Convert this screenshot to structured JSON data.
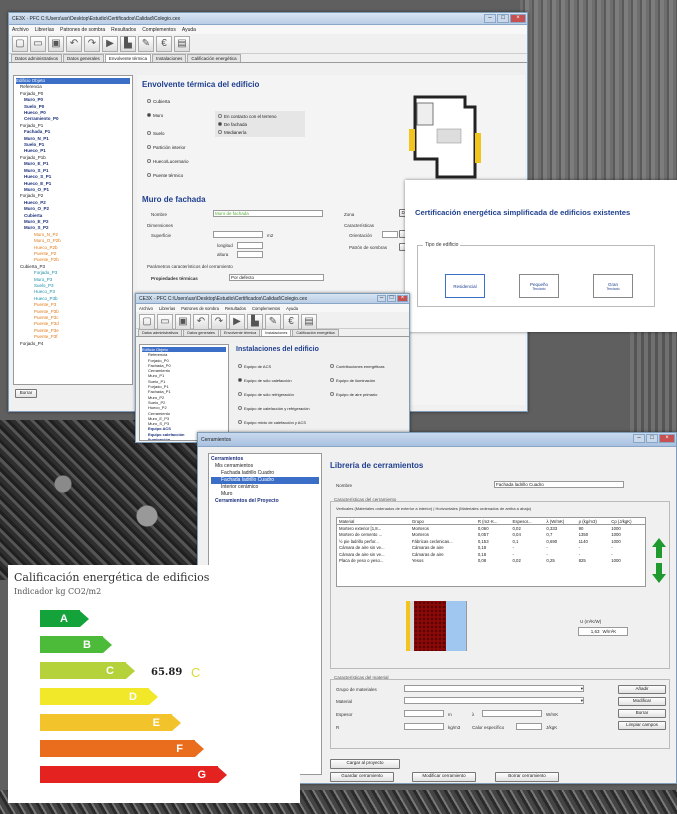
{
  "colors": {
    "accent": "#1f3f8f",
    "selection": "#3b6fc7",
    "orange": "#e07b1a",
    "cyan": "#1a8fa8"
  },
  "main_window": {
    "title": "CE3X · PFC C:\\Users\\usr\\Desktop\\Estudio\\Certificados\\Calidad\\Colegio.cex",
    "menu": [
      "Archivo",
      "Librerías",
      "Patrones de sombra",
      "Resultados",
      "Complementos",
      "Ayuda"
    ],
    "tools": [
      "new-icon",
      "open-icon",
      "save-icon",
      "undo-icon",
      "redo-icon",
      "import-icon",
      "building-icon",
      "edit-icon",
      "euro-icon",
      "report-icon"
    ],
    "tabs": [
      "Datos administrativos",
      "Datos generales",
      "Envolvente térmica",
      "Instalaciones",
      "Calificación energética"
    ],
    "tree": [
      "Edificio Objeto",
      "Referencia",
      "Forjado_P0",
      "Muro_P0",
      "Suelo_P0",
      "Hueco_P0",
      "Cerramiento_P0",
      "Forjado_P1",
      "Fachada_P1",
      "Muro_N_P1",
      "Suelo_P1",
      "Hueco_P1",
      "Forjado_P1b",
      "Muro_E_P1",
      "Muro_S_P1",
      "Hueco_S_P1",
      "Hueco_E_P1",
      "Muro_O_P1",
      "Forjado_P2",
      "Hueco_P2",
      "Muro_O_P2",
      "Cubierta",
      "Muro_E_P2",
      "Muro_S_P2",
      "Muro_N_P2",
      "Muro_O_P2b",
      "Hueco_P2b",
      "Puente_P2",
      "Puente_P2b",
      "Cubierta_P3",
      "Forjado_P3",
      "Muro_P3",
      "Suelo_P3",
      "Hueco_P3",
      "Hueco_P3b",
      "Puente_P3",
      "Puente_P3b",
      "Puente_P3c",
      "Puente_P3d",
      "Puente_P3e",
      "Puente_P3f",
      "Forjado_P4"
    ],
    "delete_button": "Borrar",
    "section_title": "Envolvente térmica del edificio",
    "envelope_options": [
      "Cubierta",
      "Muro",
      "Suelo",
      "Partición interior",
      "Hueco/Lucernario",
      "Puente térmico"
    ],
    "muro_options": [
      "En contacto con el terreno",
      "De fachada",
      "Medianería"
    ],
    "form_title": "Muro de fachada",
    "form": {
      "nombre_label": "Nombre",
      "nombre_value": "Muro de fachada",
      "zona_label": "Zona",
      "dimensiones_label": "Dimensiones",
      "superficie_label": "Superficie",
      "superficie_unit": "m2",
      "longitud_label": "longitud",
      "altura_label": "altura",
      "caracteristicas_label": "Características",
      "orientacion_label": "Orientación",
      "patron_label": "Patrón de sombras",
      "parametros_label": "Parámetros característicos del cerramiento",
      "propiedades_label": "Propiedades térmicas",
      "propiedades_value": "Por defecto",
      "parametros_right": "Parámetros",
      "add_label": "Def"
    }
  },
  "cert_panel": {
    "title": "Certificación energética simplificada de edificios existentes",
    "group_label": "Tipo de edificio",
    "options": [
      {
        "line1": "Residencial",
        "line2": ""
      },
      {
        "line1": "Pequeño",
        "line2": "Terciario"
      },
      {
        "line1": "Gran",
        "line2": "Terciario"
      }
    ]
  },
  "inst_window": {
    "title": "CE3X · PFC C:\\Users\\usr\\Desktop\\Estudio\\Certificados\\Calidad\\Colegio.cex",
    "menu": [
      "Archivo",
      "Librerías",
      "Patrones de sombra",
      "Resultados",
      "Complementos",
      "Ayuda"
    ],
    "tabs": [
      "Datos administrativos",
      "Datos generales",
      "Envolvente térmica",
      "Instalaciones",
      "Calificación energética"
    ],
    "tree": [
      "Edificio Objeto",
      "Referencia",
      "Forjado_P0",
      "Fachada_P0",
      "Cerramiento",
      "Muro_P1",
      "Suelo_P1",
      "Forjado_P1",
      "Fachada_P1",
      "Muro_P2",
      "Suelo_P2",
      "Hueco_P2",
      "Cerramiento",
      "Muro_E_P3",
      "Muro_S_P3",
      "Equipo ACS",
      "Equipo calefacción",
      "Iluminación"
    ],
    "section_title": "Instalaciones del edificio",
    "options_left": [
      "Equipo de ACS",
      "Equipo de sólo calefacción",
      "Equipo de sólo refrigeración",
      "Equipo de calefacción y refrigeración",
      "Equipo mixto de calefacción y ACS"
    ],
    "options_right": [
      "Contribuciones energéticas",
      "Equipo de iluminación",
      "Equipo de aire primario"
    ]
  },
  "cer_window": {
    "title": "Cerramientos",
    "tree": [
      "Cerramientos",
      "Mis cerramientos",
      "Fachada ladrillo Cuadro",
      "Fachada ladrillo Cuadro",
      "Interior cerámico",
      "Muro",
      "Cerramientos del Proyecto"
    ],
    "section_title": "Librería de cerramientos",
    "nombre_label": "Nombre",
    "nombre_value": "Fachada ladrillo Cuadro",
    "group_label": "Características del cerramiento",
    "hint": "Verticales (Materiales ordenados de exterior a interior) | Horizontales (Materiales ordenados de arriba a abajo)",
    "headers": [
      "Material",
      "Grupo",
      "R (m2·K...",
      "Espesor...",
      "λ (W/mK)",
      "ρ (kg/m3)",
      "Cp (J/kgK)"
    ],
    "rows": [
      [
        "Mortero exterior [1,8...",
        "Morteros",
        "0,060",
        "0,02",
        "0,333",
        "90",
        "1000"
      ],
      [
        "Mortero de cemento ...",
        "Morteros",
        "0,057",
        "0,04",
        "0,7",
        "1350",
        "1000"
      ],
      [
        "½ pie ladrillo perfor...",
        "Fábricas cerámicas...",
        "0,153",
        "0,1",
        "0,690",
        "1140",
        "1000"
      ],
      [
        "Cámara de aire sin ve...",
        "Cámaras de aire",
        "0,18",
        "-",
        "-",
        "-",
        "-"
      ],
      [
        "Cámara de aire sin ve...",
        "Cámaras de aire",
        "0,18",
        "-",
        "-",
        "-",
        "-"
      ],
      [
        "Placa de yeso o yeso...",
        "Yesos",
        "0,08",
        "0,02",
        "0,25",
        "825",
        "1000"
      ]
    ],
    "u_label": "U (m²K/W)",
    "u_value": "1,63",
    "u_unit": "W/m²K",
    "mat_group_label": "Características del material",
    "grupo_label": "Grupo de materiales",
    "material_label": "Material",
    "espesor_label": "Espesor",
    "espesor_unit": "m",
    "lambda_label": "λ",
    "lambda_unit": "W/mK",
    "r_label": "R",
    "rho_label": "ρ",
    "rho_unit": "kg/m3",
    "cp_label": "Calor específico",
    "cp_unit": "J/kgK",
    "buttons": [
      "Añadir",
      "Modificar",
      "Borrar",
      "Limpiar campos"
    ],
    "bottom_buttons": [
      "Cargar al proyecto",
      "Guardar cerramiento",
      "Modificar cerramiento",
      "Borrar cerramiento"
    ]
  },
  "label": {
    "title": "Calificación energética de edificios",
    "subtitle": "Indicador kg CO2/m2",
    "value": "65.89",
    "value_letter": "C",
    "grades": [
      {
        "letter": "A",
        "color": "#14a33b"
      },
      {
        "letter": "B",
        "color": "#4dbb3a"
      },
      {
        "letter": "C",
        "color": "#b5d23a"
      },
      {
        "letter": "D",
        "color": "#f2e82a"
      },
      {
        "letter": "E",
        "color": "#f3c32b"
      },
      {
        "letter": "F",
        "color": "#ea6d1e"
      },
      {
        "letter": "G",
        "color": "#e42321"
      }
    ]
  }
}
